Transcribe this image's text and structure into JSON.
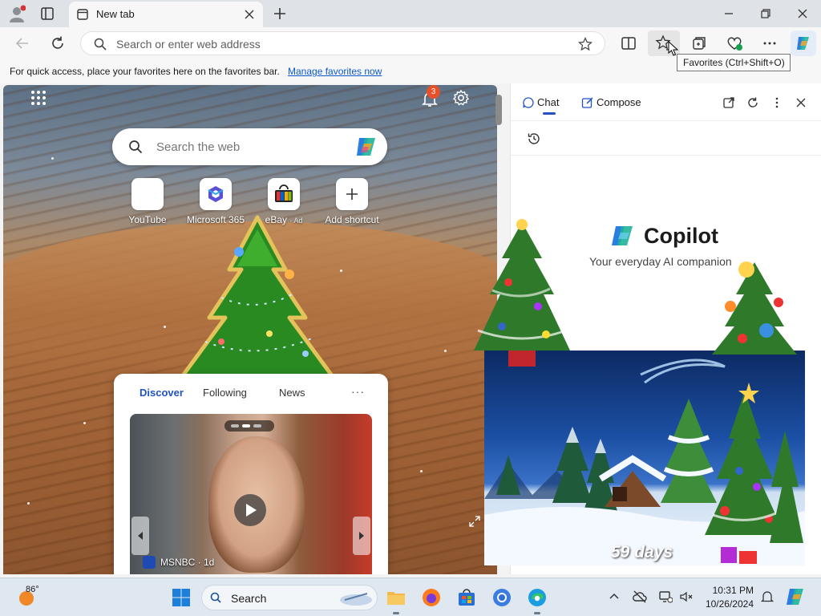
{
  "browser": {
    "tab_title": "New tab",
    "address_placeholder": "Search or enter web address",
    "favorites_tooltip": "Favorites (Ctrl+Shift+O)"
  },
  "favorites_bar": {
    "text": "For quick access, place your favorites here on the favorites bar.",
    "link": "Manage favorites now"
  },
  "new_tab_page": {
    "notification_count": "3",
    "search_placeholder": "Search the web",
    "shortcuts": [
      {
        "label": "YouTube",
        "icon": "youtube-icon"
      },
      {
        "label": "Microsoft 365",
        "icon": "microsoft-365-icon"
      },
      {
        "label": "eBay",
        "ad": "· Ad",
        "icon": "ebay-icon"
      },
      {
        "label": "Add shortcut",
        "icon": "plus-icon"
      }
    ],
    "feed": {
      "tabs": [
        "Discover",
        "Following",
        "News"
      ],
      "more": "···",
      "video_source": "MSNBC · 1d"
    }
  },
  "copilot": {
    "tabs": [
      "Chat",
      "Compose"
    ],
    "title": "Copilot",
    "subtitle": "Your everyday AI companion",
    "countdown": "59 days"
  },
  "taskbar": {
    "temperature": "86°",
    "search_label": "Search",
    "time": "10:31 PM",
    "date": "10/26/2024"
  },
  "colors": {
    "accent": "#2151c2",
    "link": "#0a58ca",
    "notification_badge": "#e8502a"
  }
}
